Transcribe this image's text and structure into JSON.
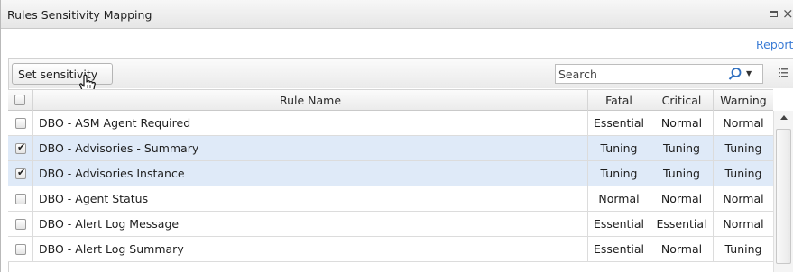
{
  "window": {
    "title": "Rules Sensitivity Mapping"
  },
  "report_link": "Report",
  "toolbar": {
    "set_sensitivity_label": "Set sensitivity"
  },
  "search": {
    "placeholder": "Search"
  },
  "columns": {
    "rule_name": "Rule Name",
    "fatal": "Fatal",
    "critical": "Critical",
    "warning": "Warning"
  },
  "rows": [
    {
      "checked": false,
      "name": "DBO - ASM Agent Required",
      "fatal": "Essential",
      "critical": "Normal",
      "warning": "Normal"
    },
    {
      "checked": true,
      "name": "DBO - Advisories - Summary",
      "fatal": "Tuning",
      "critical": "Tuning",
      "warning": "Tuning"
    },
    {
      "checked": true,
      "name": "DBO - Advisories Instance",
      "fatal": "Tuning",
      "critical": "Tuning",
      "warning": "Tuning"
    },
    {
      "checked": false,
      "name": "DBO - Agent Status",
      "fatal": "Normal",
      "critical": "Normal",
      "warning": "Normal"
    },
    {
      "checked": false,
      "name": "DBO - Alert Log Message",
      "fatal": "Essential",
      "critical": "Essential",
      "warning": "Normal"
    },
    {
      "checked": false,
      "name": "DBO - Alert Log Summary",
      "fatal": "Essential",
      "critical": "Normal",
      "warning": "Tuning"
    }
  ]
}
